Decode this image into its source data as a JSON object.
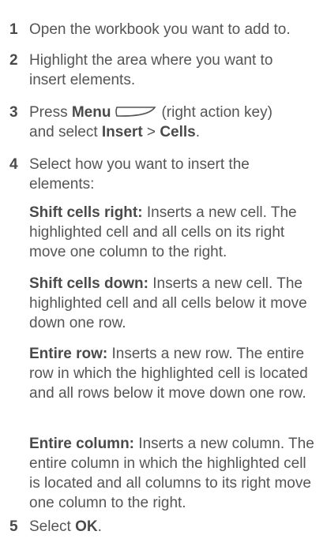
{
  "steps": [
    {
      "num": "1",
      "text": "Open the workbook you want to add to."
    },
    {
      "num": "2",
      "text": "Highlight the area where you want to insert elements."
    },
    {
      "num": "3",
      "press": "Press ",
      "menu": "Menu",
      "key_hint": "(right action key)",
      "and_select": "and select ",
      "insert": "Insert",
      "sep": " > ",
      "cells": "Cells",
      "period": "."
    },
    {
      "num": "4",
      "text": "Select how you want to insert the elements:"
    },
    {
      "num": "5",
      "select": "Select ",
      "ok": "OK",
      "period": "."
    }
  ],
  "options": [
    {
      "label": "Shift cells right:",
      "desc": " Inserts a new cell. The highlighted cell and all cells on its right move one column to the right."
    },
    {
      "label": "Shift cells down:",
      "desc": " Inserts a new cell. The highlighted cell and all cells below it move down one row."
    },
    {
      "label": "Entire row:",
      "desc": " Inserts a new row. The entire row in which the highlighted cell is located and all rows below it move down one row."
    },
    {
      "label": "Entire column:",
      "desc": " Inserts a new column. The entire column in which the highlighted cell is located and all columns to its right move one column to the right."
    }
  ]
}
